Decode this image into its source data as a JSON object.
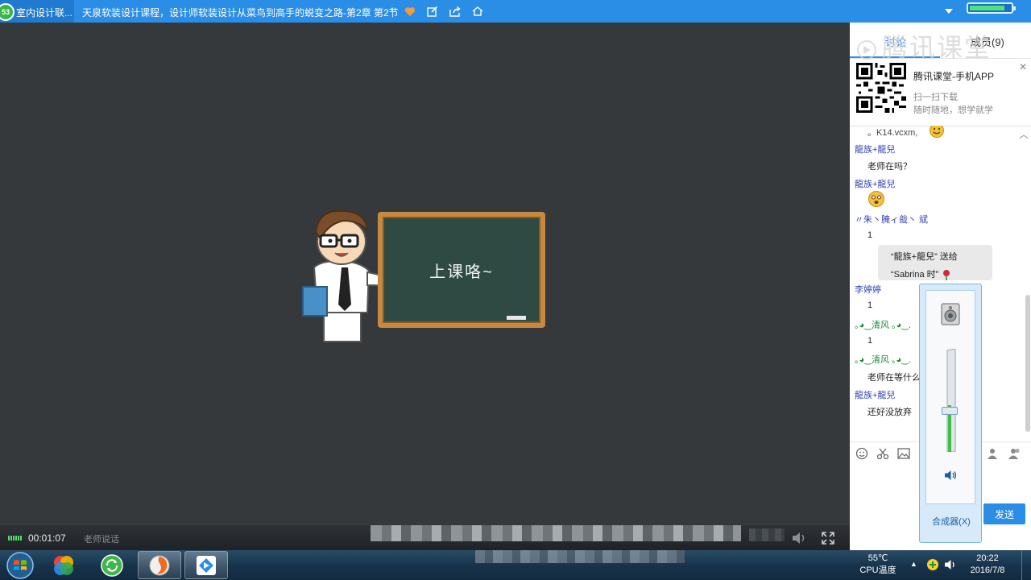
{
  "titlebar": {
    "tab_label": "室内设计联...",
    "badge": "53",
    "course_title": "天泉软装设计课程，设计师软装设计从菜鸟到高手的蜕变之路-第2章 第2节",
    "separator": "|",
    "icons": [
      "heart-icon",
      "edit-icon",
      "share-icon",
      "home-icon"
    ],
    "battery_fraction": 0.85
  },
  "video": {
    "board_text": "上课咯~"
  },
  "controlbar": {
    "elapsed": "00:01:07",
    "speaking_status": "老师说话"
  },
  "side": {
    "tabs": {
      "discuss": "讨论",
      "members": "成员(9)"
    },
    "watermark": "腾讯课堂",
    "app": {
      "title": "腾讯课堂-手机APP",
      "line1": "扫一扫下载",
      "line2": "随时随地，想学就学"
    },
    "chat": {
      "m0": "。K14.vcxm,",
      "m1_name": "龍族+龍兒",
      "m1_text": "老师在吗？",
      "m2_name": "龍族+龍兒",
      "m3_name": "〃朱丶腌ィ戠丶 斌",
      "m3_text": "1",
      "gift_l1": "“龍族+龍兒” 送给",
      "gift_l2": "“Sabrina 时”",
      "m4_name": "李婷婷",
      "m4_text": "1",
      "m5_name": "｡◕‿清风 ｡◕‿.",
      "m5_text": "1",
      "m6_name": "｡◕‿清风 ｡◕‿.",
      "m6_text": "老师在等什么",
      "m7_name": "龍族+龍兒",
      "m7_text": "还好没放弃"
    },
    "send_label": "发送"
  },
  "volume": {
    "level_fraction": 0.45,
    "mixer_label": "合成器(X)"
  },
  "taskbar": {
    "cpu_temp": "55℃",
    "cpu_label": "CPU温度",
    "time": "20:22",
    "date": "2016/7/8"
  }
}
